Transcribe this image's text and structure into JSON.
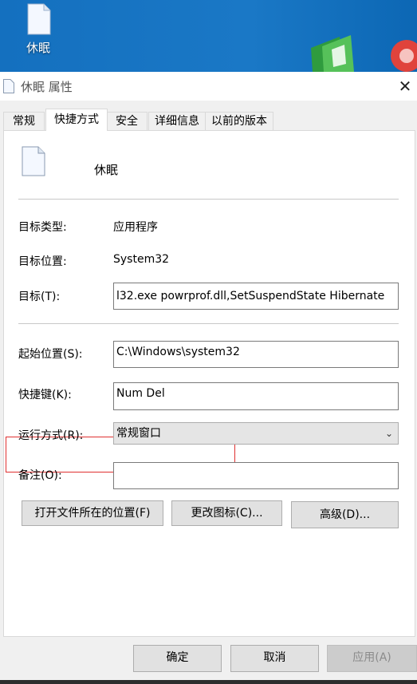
{
  "desktop": {
    "icon_label": "休眠"
  },
  "window": {
    "title": "休眠 属性",
    "close_glyph": "✕"
  },
  "tabs": [
    {
      "label": "常规"
    },
    {
      "label": "快捷方式"
    },
    {
      "label": "安全"
    },
    {
      "label": "详细信息"
    },
    {
      "label": "以前的版本"
    }
  ],
  "shortcut": {
    "name": "休眠",
    "target_type_label": "目标类型:",
    "target_type_value": "应用程序",
    "target_location_label": "目标位置:",
    "target_location_value": "System32",
    "target_label": "目标(T):",
    "target_value": "l32.exe powrprof.dll,SetSuspendState Hibernate",
    "start_in_label": "起始位置(S):",
    "start_in_value": "C:\\Windows\\system32",
    "hotkey_label": "快捷键(K):",
    "hotkey_value": "Num Del",
    "run_label": "运行方式(R):",
    "run_value": "常规窗口",
    "comment_label": "备注(O):",
    "comment_value": "",
    "open_location_button": "打开文件所在的位置(F)",
    "change_icon_button": "更改图标(C)...",
    "advanced_button": "高级(D)..."
  },
  "footer": {
    "ok": "确定",
    "cancel": "取消",
    "apply": "应用(A)"
  },
  "colors": {
    "highlight_box": "#e03030",
    "desktop": "#1673c0"
  }
}
